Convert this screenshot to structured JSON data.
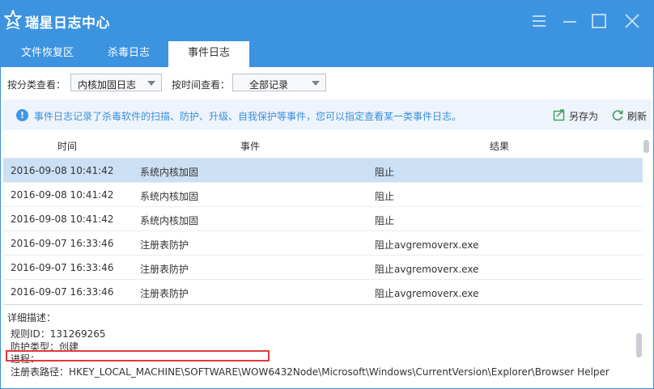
{
  "app": {
    "title": "瑞星日志中心"
  },
  "tabs": [
    {
      "label": "文件恢复区"
    },
    {
      "label": "杀毒日志"
    },
    {
      "label": "事件日志"
    }
  ],
  "filters": {
    "category_label": "按分类查看：",
    "category_value": "内核加固日志",
    "time_label": "按时间查看：",
    "time_value": "全部记录"
  },
  "info": {
    "text": "事件日志记录了杀毒软件的扫描、防护、升级、自我保护等事件，您可以指定查看某一类事件日志。",
    "save_as": "另存为",
    "refresh": "刷新"
  },
  "table": {
    "headers": {
      "time": "时间",
      "event": "事件",
      "result": "结果"
    },
    "rows": [
      {
        "time": "2016-09-08 10:41:42",
        "event": "系统内核加固",
        "result": "阻止"
      },
      {
        "time": "2016-09-08 10:41:42",
        "event": "系统内核加固",
        "result": "阻止"
      },
      {
        "time": "2016-09-08 10:41:42",
        "event": "系统内核加固",
        "result": "阻止"
      },
      {
        "time": "2016-09-07 16:33:46",
        "event": "注册表防护",
        "result": "阻止avgremoverx.exe"
      },
      {
        "time": "2016-09-07 16:33:46",
        "event": "注册表防护",
        "result": "阻止avgremoverx.exe"
      },
      {
        "time": "2016-09-07 16:33:46",
        "event": "注册表防护",
        "result": "阻止avgremoverx.exe"
      }
    ]
  },
  "detail": {
    "heading": "详细描述：",
    "rule_id": "规则ID：131269265",
    "protect_type": "防护类型：创建",
    "process": "进程：",
    "reg_path": "注册表路径：HKEY_LOCAL_MACHINE\\SOFTWARE\\WOW6432Node\\Microsoft\\Windows\\CurrentVersion\\Explorer\\Browser Helper"
  },
  "colors": {
    "title_bar": "#3c93e0",
    "info_text": "#3a8fde",
    "selected_row": "#cce0f5",
    "highlight_box": "#e03a3a"
  }
}
